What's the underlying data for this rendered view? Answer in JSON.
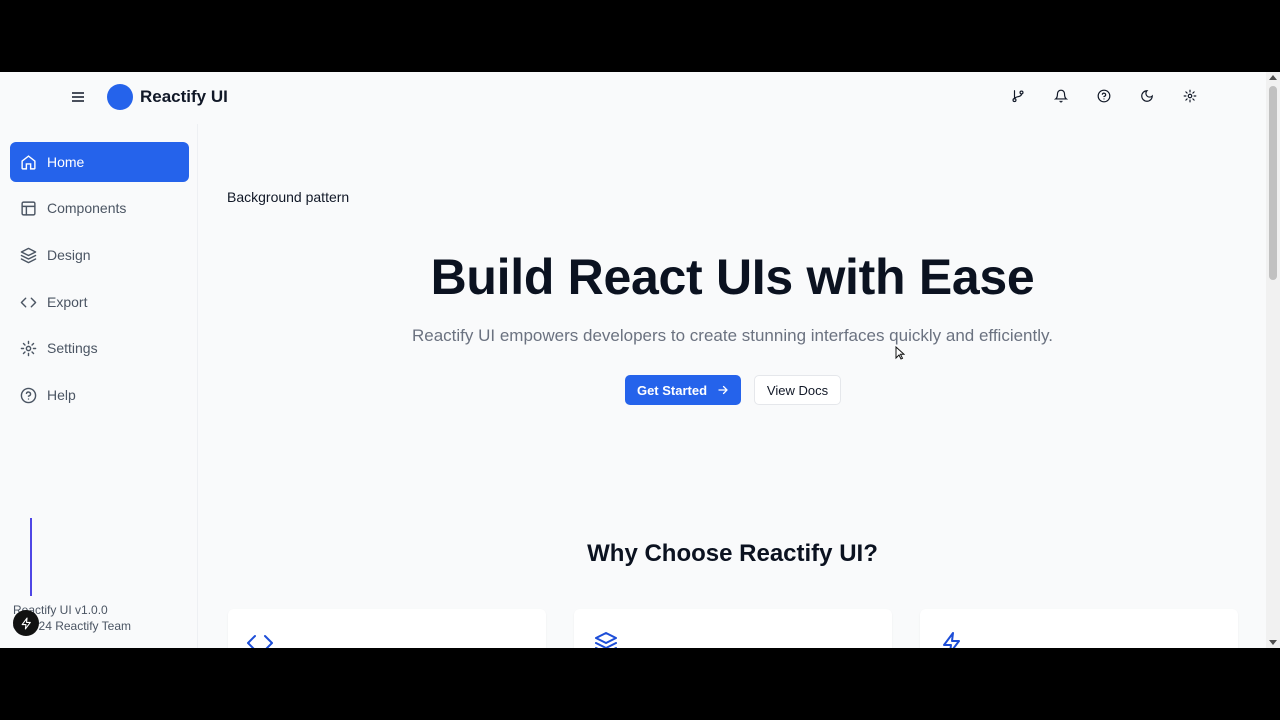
{
  "header": {
    "brand": "Reactify UI",
    "icons": [
      "git-branch-icon",
      "bell-icon",
      "help-circle-icon",
      "moon-icon",
      "settings-icon"
    ]
  },
  "sidebar": {
    "items": [
      {
        "label": "Home",
        "icon": "home-icon",
        "active": true
      },
      {
        "label": "Components",
        "icon": "layout-icon",
        "active": false
      },
      {
        "label": "Design",
        "icon": "layers-icon",
        "active": false
      },
      {
        "label": "Export",
        "icon": "code-icon",
        "active": false
      },
      {
        "label": "Settings",
        "icon": "gear-icon",
        "active": false
      },
      {
        "label": "Help",
        "icon": "help-circle-icon",
        "active": false
      }
    ],
    "version": "Reactify UI v1.0.0",
    "copyright": "© 2024 Reactify Team"
  },
  "hero": {
    "image_alt": "Background pattern",
    "title": "Build React UIs with Ease",
    "subtitle": "Reactify UI empowers developers to create stunning interfaces quickly and efficiently.",
    "primary_button": "Get Started",
    "secondary_button": "View Docs"
  },
  "features": {
    "title": "Why Choose Reactify UI?",
    "cards": [
      {
        "icon": "code-icon"
      },
      {
        "icon": "layers-icon"
      },
      {
        "icon": "zap-icon"
      }
    ]
  },
  "colors": {
    "accent": "#2563eb",
    "background": "#f9fafb",
    "text": "#111827",
    "muted": "#6b7280"
  }
}
